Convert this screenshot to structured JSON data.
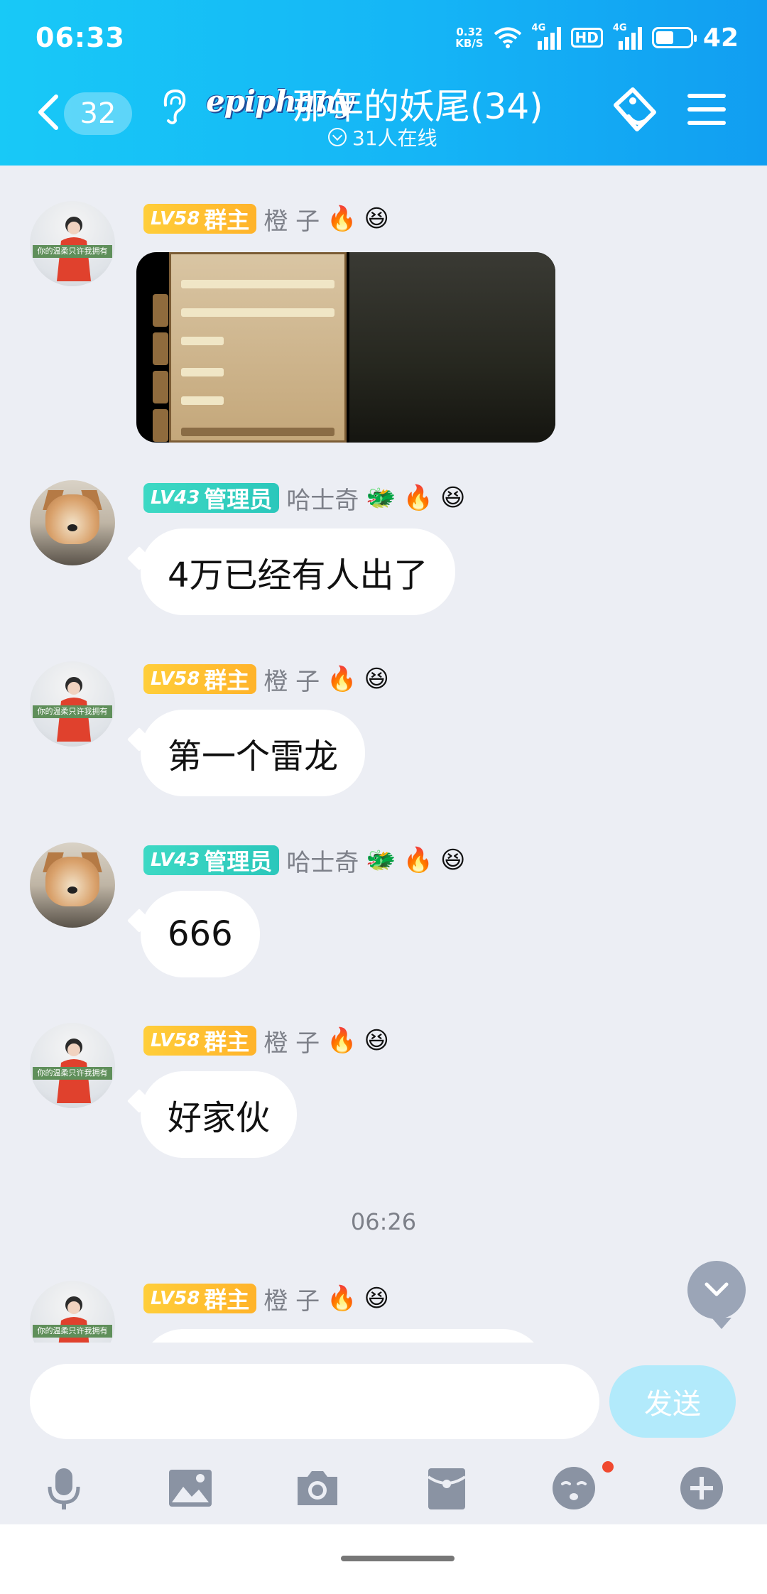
{
  "status_bar": {
    "time": "06:33",
    "net_speed_value": "0.32",
    "net_speed_unit": "KB/S",
    "network_1": "4G",
    "hd": "HD",
    "network_2": "4G",
    "battery": "42"
  },
  "header": {
    "unread_count": "32",
    "group_logo": "epiphany",
    "group_name": "那年的妖尾(34)",
    "online_status": "31人在线"
  },
  "messages": [
    {
      "level": "LV58",
      "role": "群主",
      "name": "橙 子",
      "icons": [
        "🔥",
        "😆"
      ],
      "type": "image"
    },
    {
      "level": "LV43",
      "role": "管理员",
      "name": "哈士奇",
      "icons": [
        "🐲",
        "🔥",
        "😆"
      ],
      "type": "text",
      "text": "4万已经有人出了"
    },
    {
      "level": "LV58",
      "role": "群主",
      "name": "橙 子",
      "icons": [
        "🔥",
        "😆"
      ],
      "type": "text",
      "text": "第一个雷龙"
    },
    {
      "level": "LV43",
      "role": "管理员",
      "name": "哈士奇",
      "icons": [
        "🐲",
        "🔥",
        "😆"
      ],
      "type": "text",
      "text": "666"
    },
    {
      "level": "LV58",
      "role": "群主",
      "name": "橙 子",
      "icons": [
        "🔥",
        "😆"
      ],
      "type": "text",
      "text": "好家伙"
    },
    {
      "level": "LV58",
      "role": "群主",
      "name": "橙 子",
      "icons": [
        "🔥",
        "😆"
      ],
      "type": "text",
      "text": ""
    }
  ],
  "timestamp": "06:26",
  "avatar_caption": "你的温柔只许我拥有",
  "input": {
    "placeholder": "",
    "send_label": "发送"
  },
  "toolbar_icons": [
    "microphone-icon",
    "image-icon",
    "camera-icon",
    "red-packet-icon",
    "emoji-icon",
    "plus-icon"
  ],
  "colors": {
    "header_start": "#18c9f7",
    "header_end": "#119ef1",
    "owner_badge": "#ffc233",
    "admin_badge": "#2fcfc0",
    "send_disabled": "#b2eafb",
    "background": "#eceef4"
  }
}
